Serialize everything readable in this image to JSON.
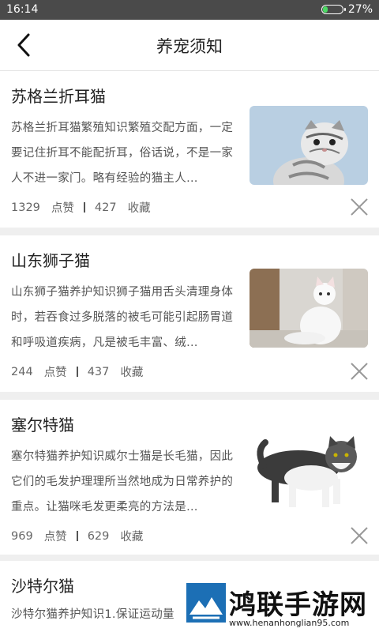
{
  "status_bar": {
    "time": "16:14",
    "battery_text": "27%",
    "battery_level": 0.27
  },
  "header": {
    "title": "养宠须知",
    "back_icon": "chevron-left-icon"
  },
  "articles": [
    {
      "title": "苏格兰折耳猫",
      "summary": "苏格兰折耳猫繁殖知识繁殖交配方面，一定要记住折耳不能配折耳，俗话说，不是一家人不进一家门。略有经验的猫主人…",
      "likes": "1329",
      "likes_label": "点赞",
      "favorites": "427",
      "favorites_label": "收藏",
      "image": "grey-tabby-kitten-photo"
    },
    {
      "title": "山东狮子猫",
      "summary": "山东狮子猫养护知识狮子猫用舌头清理身体时，若吞食过多脱落的被毛可能引起肠胃道和呼吸道疾病，凡是被毛丰富、绒…",
      "likes": "244",
      "likes_label": "点赞",
      "favorites": "437",
      "favorites_label": "收藏",
      "image": "white-longhair-cat-photo"
    },
    {
      "title": "塞尔特猫",
      "summary": "塞尔特猫养护知识威尔士猫是长毛猫，因此它们的毛发护理理所当然地成为日常养护的重点。让猫咪毛发更柔亮的方法是…",
      "likes": "969",
      "likes_label": "点赞",
      "favorites": "629",
      "favorites_label": "收藏",
      "image": "black-white-cat-photo"
    },
    {
      "title": "沙特尔猫",
      "summary": "沙特尔猫养护知识1.保证运动量",
      "image": ""
    }
  ],
  "watermark": {
    "brand": "鸿联手游网",
    "domain": "www.henanhonglian95.com"
  }
}
